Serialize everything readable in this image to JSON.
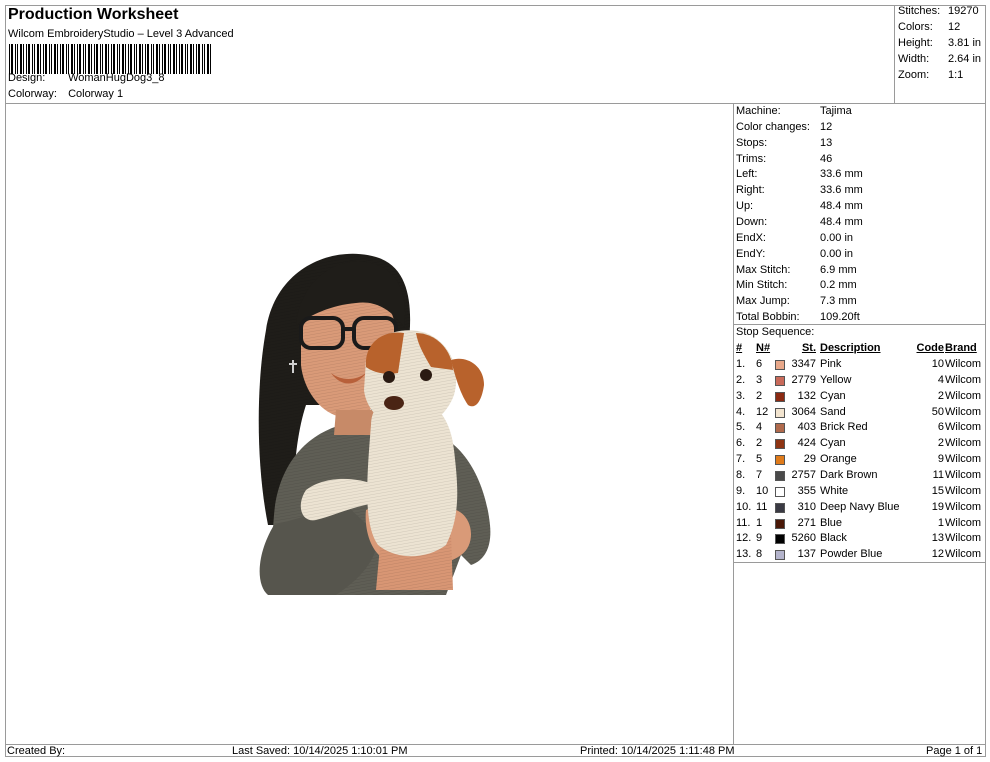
{
  "header": {
    "title": "Production Worksheet",
    "subtitle": "Wilcom EmbroideryStudio – Level 3 Advanced",
    "design_label": "Design:",
    "design_value": "WomanHugDog3_8",
    "colorway_label": "Colorway:",
    "colorway_value": "Colorway 1"
  },
  "summary": [
    {
      "k": "Stitches:",
      "v": "19270"
    },
    {
      "k": "Colors:",
      "v": "12"
    },
    {
      "k": "Height:",
      "v": "3.81 in"
    },
    {
      "k": "Width:",
      "v": "2.64 in"
    },
    {
      "k": "Zoom:",
      "v": "1:1"
    }
  ],
  "stats": [
    {
      "k": "Machine:",
      "v": "Tajima"
    },
    {
      "k": "Color changes:",
      "v": "12"
    },
    {
      "k": "Stops:",
      "v": "13"
    },
    {
      "k": "Trims:",
      "v": "46"
    },
    {
      "k": "Left:",
      "v": "33.6 mm"
    },
    {
      "k": "Right:",
      "v": "33.6 mm"
    },
    {
      "k": "Up:",
      "v": "48.4 mm"
    },
    {
      "k": "Down:",
      "v": "48.4 mm"
    },
    {
      "k": "EndX:",
      "v": "0.00 in"
    },
    {
      "k": "EndY:",
      "v": "0.00 in"
    },
    {
      "k": "Max Stitch:",
      "v": "6.9 mm"
    },
    {
      "k": "Min Stitch:",
      "v": "0.2 mm"
    },
    {
      "k": "Max Jump:",
      "v": "7.3 mm"
    },
    {
      "k": "Total Bobbin:",
      "v": "109.20ft"
    }
  ],
  "sequence": {
    "title": "Stop Sequence:",
    "headers": {
      "num": "#",
      "n": "N#",
      "st": "St.",
      "desc": "Description",
      "code": "Code",
      "brand": "Brand"
    },
    "rows": [
      {
        "num": "1.",
        "n": "6",
        "color": "#e8a88a",
        "st": "3347",
        "desc": "Pink",
        "code": "10",
        "brand": "Wilcom"
      },
      {
        "num": "2.",
        "n": "3",
        "color": "#c96a5a",
        "st": "2779",
        "desc": "Yellow",
        "code": "4",
        "brand": "Wilcom"
      },
      {
        "num": "3.",
        "n": "2",
        "color": "#8b2a12",
        "st": "132",
        "desc": "Cyan",
        "code": "2",
        "brand": "Wilcom"
      },
      {
        "num": "4.",
        "n": "12",
        "color": "#f2e4cf",
        "st": "3064",
        "desc": "Sand",
        "code": "50",
        "brand": "Wilcom"
      },
      {
        "num": "5.",
        "n": "4",
        "color": "#b06a4c",
        "st": "403",
        "desc": "Brick Red",
        "code": "6",
        "brand": "Wilcom"
      },
      {
        "num": "6.",
        "n": "2",
        "color": "#8e3412",
        "st": "424",
        "desc": "Cyan",
        "code": "2",
        "brand": "Wilcom"
      },
      {
        "num": "7.",
        "n": "5",
        "color": "#e07b1a",
        "st": "29",
        "desc": "Orange",
        "code": "9",
        "brand": "Wilcom"
      },
      {
        "num": "8.",
        "n": "7",
        "color": "#4a4a4a",
        "st": "2757",
        "desc": "Dark Brown",
        "code": "11",
        "brand": "Wilcom"
      },
      {
        "num": "9.",
        "n": "10",
        "color": "#ffffff",
        "st": "355",
        "desc": "White",
        "code": "15",
        "brand": "Wilcom"
      },
      {
        "num": "10.",
        "n": "11",
        "color": "#3a3a44",
        "st": "310",
        "desc": "Deep Navy Blue",
        "code": "19",
        "brand": "Wilcom"
      },
      {
        "num": "11.",
        "n": "1",
        "color": "#4a1808",
        "st": "271",
        "desc": "Blue",
        "code": "1",
        "brand": "Wilcom"
      },
      {
        "num": "12.",
        "n": "9",
        "color": "#000000",
        "st": "5260",
        "desc": "Black",
        "code": "13",
        "brand": "Wilcom"
      },
      {
        "num": "13.",
        "n": "8",
        "color": "#b4b4cc",
        "st": "137",
        "desc": "Powder Blue",
        "code": "12",
        "brand": "Wilcom"
      }
    ]
  },
  "footer": {
    "created": "Created By:",
    "saved": "Last Saved: 10/14/2025 1:10:01 PM",
    "printed": "Printed: 10/14/2025 1:11:48 PM",
    "page": "Page 1 of 1"
  },
  "illustration": {
    "subject": "woman-hugging-dog-embroidery",
    "colors": {
      "hair": "#1f1d19",
      "sweater": "#5f5e55",
      "skin": "#d99a78",
      "dog_white": "#ece3d2",
      "dog_brown": "#b8622c"
    }
  }
}
